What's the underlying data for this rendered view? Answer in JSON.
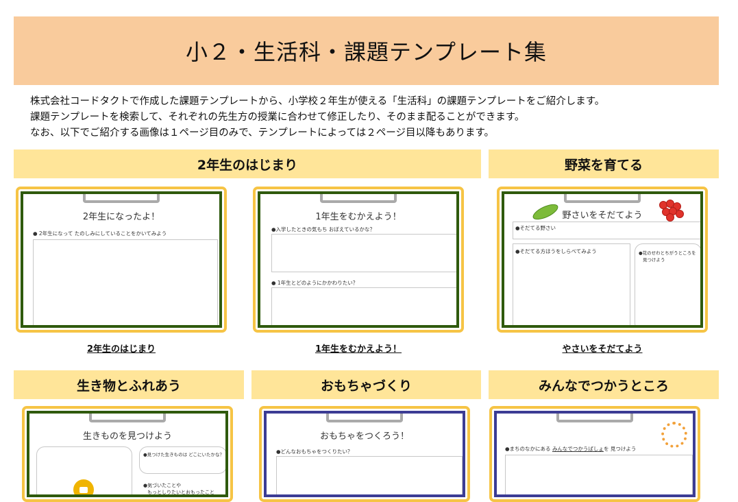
{
  "page": {
    "title": "小２・生活科・課題テンプレート集",
    "intro": [
      "株式会社コードタクトで作成した課題テンプレートから、小学校２年生が使える「生活科」の課題テンプレートをご紹介します。",
      "課題テンプレートを検索して、それぞれの先生方の授業に合わせて修正したり、そのまま配ることができます。",
      "なお、以下でご紹介する画像は１ページ目のみで、テンプレートによっては２ページ目以降もあります。"
    ]
  },
  "sections": {
    "s1": "2年生のはじまり",
    "s2": "野菜を育てる",
    "s3": "生き物とふれあう",
    "s4": "おもちゃづくり",
    "s5": "みんなでつかうところ"
  },
  "cards": {
    "c1": {
      "title": "2年生になったよ！",
      "q1": "● 2年生になって たのしみにしていることをかいてみよう",
      "caption": "2年生のはじまり"
    },
    "c2": {
      "title": "1年生をむかえよう！",
      "q1": "●入学したときの気もち おぼえているかな？",
      "q2": "● 1年生とどのようにかかわりたい？",
      "caption": "1年生をむかえよう！"
    },
    "c3": {
      "title": "野さいをそだてよう",
      "q1": "●そだてる野さい",
      "q2": "●そだてる方ほうをしらべてみよう",
      "q3a": "●花のせわとちがうところを",
      "q3b": "見つけよう",
      "caption": "やさいをそだてよう"
    },
    "c4": {
      "title": "生きものを見つけよう",
      "q1": "●見つけた生きものは どこにいたかな？",
      "q2a": "●気づいたことや",
      "q2b": "もっとしりたいとおもったこと"
    },
    "c5": {
      "title": "おもちゃをつくろう！",
      "q1": "●どんなおもちゃをつくりたい？"
    },
    "c6": {
      "q1a": "●まちのなかにある ",
      "q1b": "みんなでつかうばしょ",
      "q1c": "を 見つけよう"
    }
  },
  "colors": {
    "banner": "#f9cb9c",
    "section": "#ffe599",
    "card_border": "#f6c445",
    "green_frame": "#2f5a0d",
    "purple_frame": "#3c3c94"
  },
  "icons": [
    "pea-icon",
    "tomato-icon",
    "camera-icon",
    "children-circle-icon",
    "clipboard-clip-icon"
  ]
}
